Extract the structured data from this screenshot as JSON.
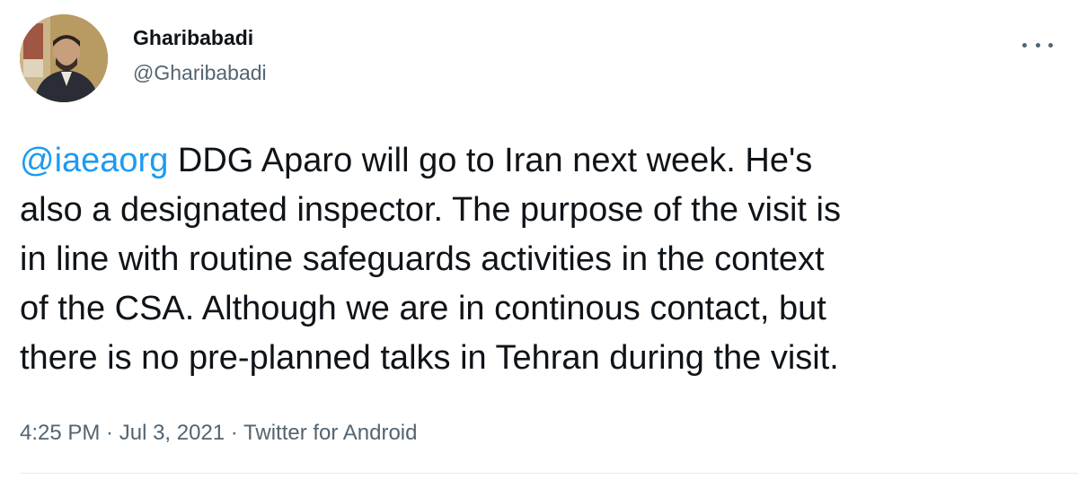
{
  "author": {
    "display_name": "Gharibabadi",
    "handle": "@Gharibabadi"
  },
  "tweet": {
    "mention": "@iaeaorg",
    "text": " DDG Aparo will go to Iran next week. He's\nalso a designated inspector. The purpose of the visit is\nin line with routine safeguards activities in the context\nof the CSA. Although we are in continous contact, but\nthere is no pre-planned talks in Tehran during the visit.",
    "time": "4:25 PM",
    "separator": " · ",
    "date": "Jul 3, 2021",
    "source": "Twitter for Android"
  },
  "icons": {
    "more": "more-horizontal-icon"
  },
  "colors": {
    "link": "#1d9bf0",
    "secondary_text": "#536471",
    "primary_text": "#0f1419"
  }
}
